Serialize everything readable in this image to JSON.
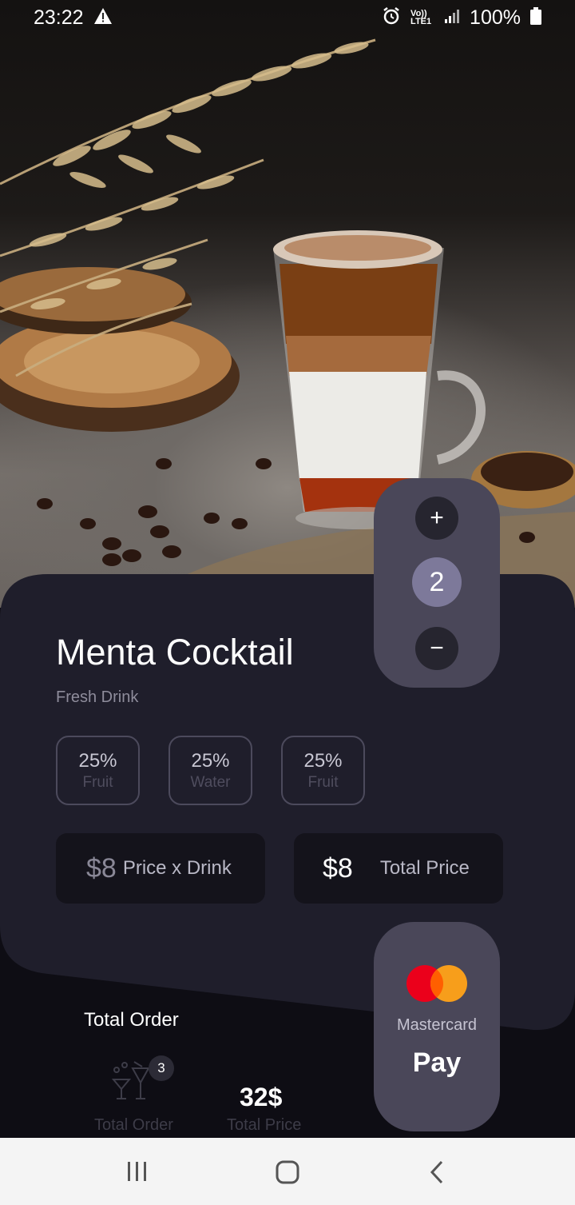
{
  "status_bar": {
    "time": "23:22",
    "network": "Vo)) LTE1",
    "battery": "100%",
    "icons": [
      "warning-icon",
      "alarm-icon",
      "signal-icon",
      "battery-icon"
    ]
  },
  "hero": {
    "image": "iced-coffee-glass-photo"
  },
  "product": {
    "name": "Menta Cocktail",
    "subtitle": "Fresh Drink",
    "ingredients": [
      {
        "percent": "25%",
        "name": "Fruit"
      },
      {
        "percent": "25%",
        "name": "Water"
      },
      {
        "percent": "25%",
        "name": "Fruit"
      }
    ],
    "price_per_drink": "$8",
    "price_per_drink_label": "Price x Drink",
    "total_price": "$8",
    "total_price_label": "Total Price"
  },
  "stepper": {
    "plus": "+",
    "minus": "−",
    "quantity": "2"
  },
  "payment": {
    "method": "Mastercard",
    "action": "Pay"
  },
  "summary": {
    "heading": "Total Order",
    "order_count": "3",
    "order_caption": "Total Order",
    "total_value": "32$",
    "total_caption": "Total Price"
  },
  "colors": {
    "background": "#0e0d14",
    "card": "#1f1e2b",
    "stepper": "#4a4759",
    "quantity_bubble": "#7d799a",
    "mastercard_red": "#eb001b",
    "mastercard_orange": "#f79e1b"
  }
}
